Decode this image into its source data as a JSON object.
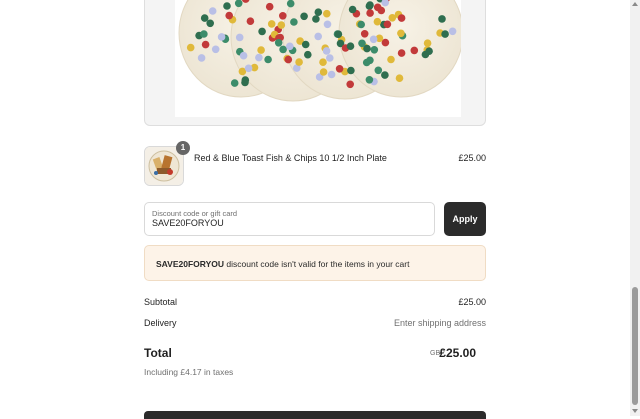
{
  "cart": {
    "item": {
      "title": "Red & Blue Toast Fish & Chips 10 1/2 Inch Plate",
      "price": "£25.00",
      "quantity": "1",
      "thumbnail_icon": "plate-thumbnail-image"
    }
  },
  "discount": {
    "label": "Discount code or gift card",
    "value": "SAVE20FORYOU",
    "apply_label": "Apply"
  },
  "notice": {
    "code": "SAVE20FORYOU",
    "message": " discount code isn't valid for the items in your cart"
  },
  "summary": {
    "subtotal_label": "Subtotal",
    "subtotal_value": "£25.00",
    "delivery_label": "Delivery",
    "delivery_value": "Enter shipping address",
    "total_label": "Total",
    "currency": "GBP",
    "total_value": "£25.00",
    "taxes_note": "Including £4.17 in taxes"
  },
  "colors": {
    "button_bg": "#2b2b2b",
    "notice_bg": "#fdf3e8",
    "muted_text": "#707070"
  }
}
